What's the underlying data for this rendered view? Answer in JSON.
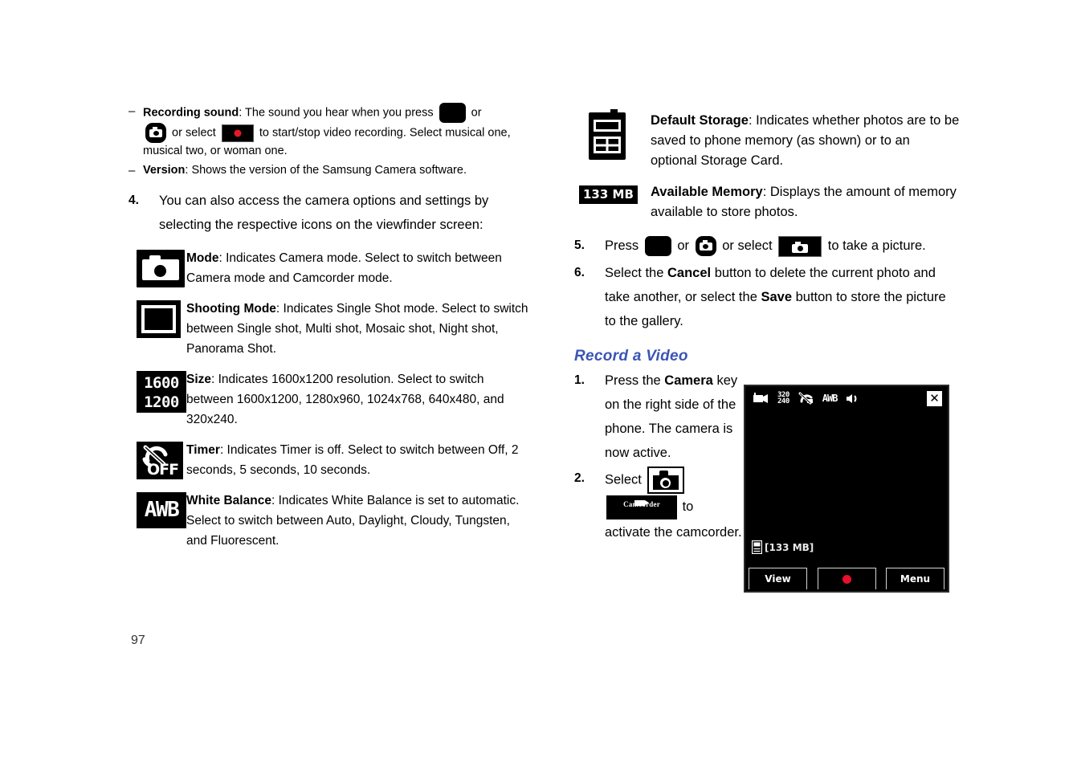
{
  "page": {
    "number": "97"
  },
  "left_column": {
    "bullets": [
      {
        "dash": "–",
        "term": "Recording sound",
        "text_1": ": The sound you hear when you press",
        "text_2": "or",
        "text_3": "or select",
        "text_4": "to start/stop video recording. Select musical one, musical two, or woman one."
      },
      {
        "dash": "–",
        "term": "Version",
        "text_1": ": Shows the version of the Samsung Camera software."
      }
    ],
    "step4": {
      "number": "4.",
      "text": "You can also access the camera options and settings by selecting the respective icons on the viewfinder screen:"
    },
    "definitions": [
      {
        "icon": "camera-mode-icon",
        "term": "Mode",
        "text": ": Indicates Camera mode. Select to switch between Camera mode and Camcorder mode."
      },
      {
        "icon": "shooting-mode-icon",
        "term": "Shooting Mode",
        "text": ": Indicates Single Shot mode. Select to switch between Single shot, Multi shot, Mosaic shot, Night shot, Panorama Shot."
      },
      {
        "icon": "resolution-icon",
        "icon_line1": "1600",
        "icon_line2": "1200",
        "term": "Size",
        "text": ": Indicates 1600x1200 resolution. Select to switch between 1600x1200, 1280x960, 1024x768, 640x480, and 320x240."
      },
      {
        "icon": "timer-off-icon",
        "icon_label": "OFF",
        "term": "Timer",
        "text": ": Indicates Timer is off. Select to switch between Off, 2 seconds, 5 seconds, 10 seconds."
      },
      {
        "icon": "white-balance-icon",
        "icon_label": "AWB",
        "term": "White Balance",
        "text": ": Indicates White Balance is set to automatic. Select to switch between Auto, Daylight, Cloudy, Tungsten, and Fluorescent."
      }
    ]
  },
  "right_column": {
    "definitions": [
      {
        "icon": "default-storage-icon",
        "term": "Default Storage",
        "text": ": Indicates whether photos are to be saved to phone memory (as shown) or to an optional Storage Card."
      },
      {
        "icon": "available-memory-badge",
        "icon_label": "133 MB",
        "term": "Available Memory",
        "text": ": Displays the amount of memory available to store photos."
      }
    ],
    "step5": {
      "number": "5.",
      "text_1": "Press",
      "text_2": "or",
      "text_3": "or select",
      "text_4": "to take a picture."
    },
    "step6": {
      "number": "6.",
      "text_1": "Select the",
      "term_1": "Cancel",
      "text_2": "button to delete the current photo and take another, or select the",
      "term_2": "Save",
      "text_3": "button to store the picture to the gallery."
    },
    "heading": "Record a Video",
    "step1": {
      "number": "1.",
      "text_1": "Press the",
      "term_1": "Camera",
      "text_2": "key on the right side of the phone. The camera is now active."
    },
    "step2": {
      "number": "2.",
      "text_1": "Select",
      "text_2": "to",
      "text_3": "activate the camcorder.",
      "camcorder_label": "Camcorder"
    },
    "phone_screenshot": {
      "name": "camcorder-viewfinder",
      "status_icons": [
        "camcorder-mode-icon",
        "resolution-320x240-icon",
        "timer-off-icon",
        "white-balance-awb-icon",
        "sound-on-icon"
      ],
      "resolution_line1": "320",
      "resolution_line2": "240",
      "awb_label": "AWB",
      "close_label": "✕",
      "memory_text": "[133 MB]",
      "softkeys": [
        {
          "name": "view-softkey",
          "label": "View"
        },
        {
          "name": "record-softkey",
          "label": ""
        },
        {
          "name": "menu-softkey",
          "label": "Menu"
        }
      ]
    }
  },
  "colors": {
    "heading_blue": "#3b55b5",
    "record_red": "#e8102a",
    "ink": "#000000"
  }
}
